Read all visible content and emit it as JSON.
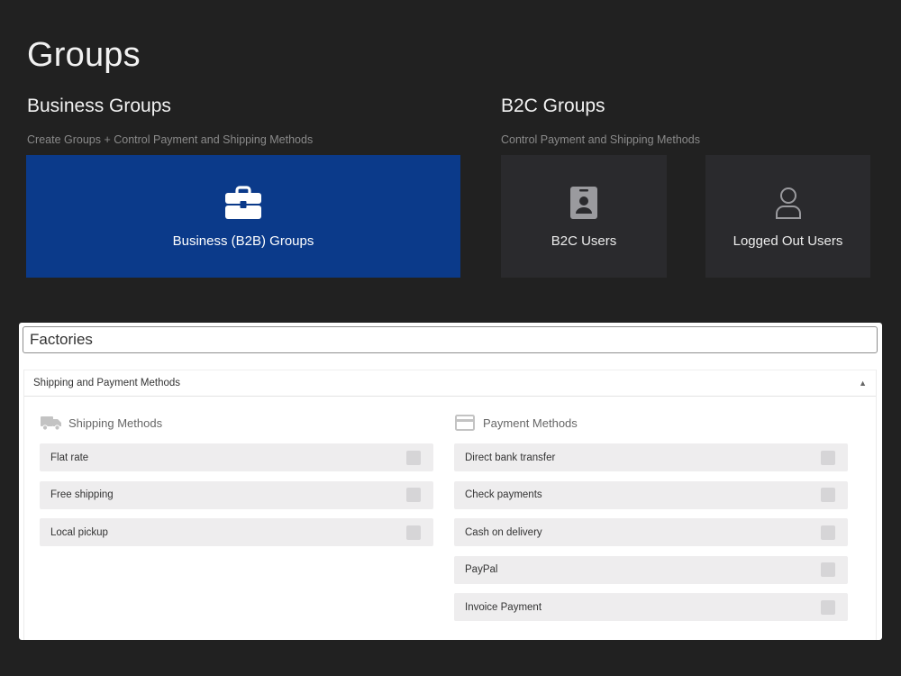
{
  "page": {
    "title": "Groups"
  },
  "business": {
    "title": "Business Groups",
    "subtitle": "Create Groups + Control Payment and Shipping Methods",
    "card": {
      "label": "Business (B2B) Groups",
      "icon": "briefcase-icon",
      "color": "#0b3a8a"
    }
  },
  "b2c": {
    "title": "B2C Groups",
    "subtitle": "Control Payment and Shipping Methods",
    "cards": [
      {
        "label": "B2C Users",
        "icon": "id-badge-icon"
      },
      {
        "label": "Logged Out Users",
        "icon": "user-outline-icon"
      }
    ]
  },
  "group_form": {
    "name_value": "Factories",
    "accordion_title": "Shipping and Payment Methods",
    "shipping": {
      "heading": "Shipping Methods",
      "icon": "truck-icon",
      "methods": [
        "Flat rate",
        "Free shipping",
        "Local pickup"
      ]
    },
    "payment": {
      "heading": "Payment Methods",
      "icon": "credit-card-icon",
      "methods": [
        "Direct bank transfer",
        "Check payments",
        "Cash on delivery",
        "PayPal",
        "Invoice Payment"
      ]
    }
  }
}
